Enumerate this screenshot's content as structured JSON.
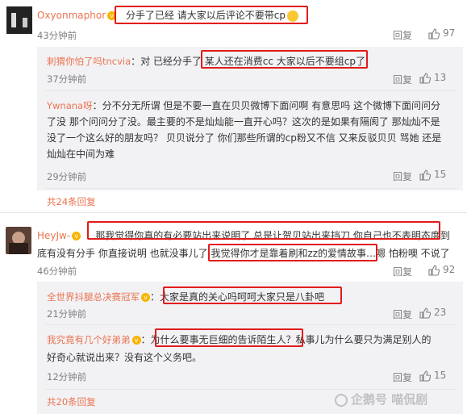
{
  "comments": [
    {
      "user": "Oxyonmaphor",
      "text": "分手了已经 请大家以后评论不要带cp",
      "time": "43分钟前",
      "reply_label": "回复",
      "likes": "97",
      "replies": [
        {
          "user": "刺猬你怕了吗tncvia",
          "text": "：对 已经分手了 某人还在消费cc 大家以后不要组cp了",
          "time": "37分钟前",
          "reply_label": "回复",
          "likes": "13"
        },
        {
          "user": "Ywnana呀",
          "text_lines": [
            "：分不分无所谓 但是不要一直在贝贝微博下面问啊 有意思吗 这个微博下面问问分",
            "了没 那个问问分了没。最主要的不是灿灿能一直开心吗？这次的是如果有隔阂了 那灿灿不是",
            "没了一个这么好的朋友吗？ 贝贝说分了 你们那些所谓的cp粉又不信 又来反驳贝贝 骂她 还是",
            "灿灿在中间为难"
          ],
          "time": "29分钟前",
          "reply_label": "回复",
          "likes": "15"
        }
      ],
      "more": "共24条回复"
    },
    {
      "user": "HeyJw-",
      "text_lines": [
        "：那我觉得你真的有必要站出来说明了 总是让贺贝站出来挡刀 你自己也不表明态度到",
        "底有没有分手 你直接说明 也就没事儿了 我觉得你才是靠着刷和zz的爱情故事…嗯 怕粉噢 不说了"
      ],
      "time": "46分钟前",
      "reply_label": "回复",
      "likes": "92",
      "replies": [
        {
          "user": "全世界抖腿总决赛冠军",
          "text": "：大家是真的关心吗呵呵大家只是八卦吧",
          "time": "21分钟前",
          "reply_label": "回复",
          "likes": "23"
        },
        {
          "user": "我究竟有几个好弟弟",
          "text_lines": [
            "：为什么要事无巨细的告诉陌生人？私事儿为什么要只为满足别人的",
            "好奇心就说出来？没有这个义务吧。"
          ],
          "time": "12分钟前",
          "reply_label": "回复",
          "likes": "15"
        }
      ],
      "more": "共20条回复"
    }
  ],
  "watermark": "企鹅号 喵侃剧"
}
